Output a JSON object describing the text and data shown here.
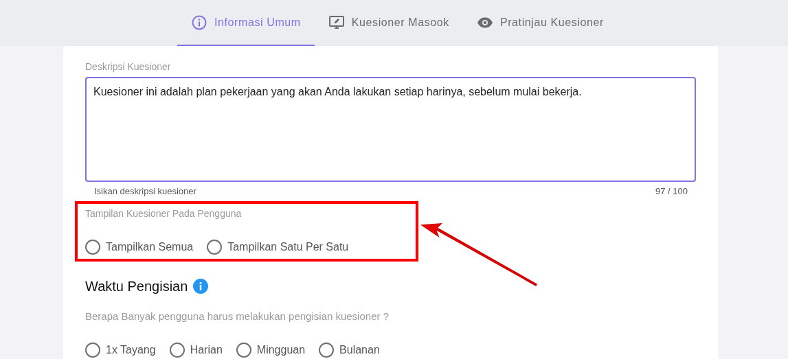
{
  "tabs": [
    {
      "label": "Informasi Umum",
      "selected": true
    },
    {
      "label": "Kuesioner Masook",
      "selected": false
    },
    {
      "label": "Pratinjau Kuesioner",
      "selected": false
    }
  ],
  "description": {
    "label": "Deskripsi Kuesioner",
    "value": "Kuesioner ini adalah plan pekerjaan yang akan Anda lakukan setiap harinya, sebelum mulai bekerja.",
    "hint": "Isikan deskripsi kuesioner",
    "counter": "97 / 100"
  },
  "display_mode": {
    "label": "Tampilan Kuesioner Pada Pengguna",
    "highlighted": true,
    "options": [
      {
        "label": "Tampilkan Semua",
        "selected": false
      },
      {
        "label": "Tampilkan Satu Per Satu",
        "selected": false
      }
    ]
  },
  "fill_time": {
    "heading": "Waktu Pengisian",
    "question": "Berapa Banyak pengguna harus melakukan pengisian kuesioner ?",
    "options": [
      {
        "label": "1x Tayang",
        "selected": false
      },
      {
        "label": "Harian",
        "selected": false
      },
      {
        "label": "Mingguan",
        "selected": false
      },
      {
        "label": "Bulanan",
        "selected": false
      }
    ]
  }
}
